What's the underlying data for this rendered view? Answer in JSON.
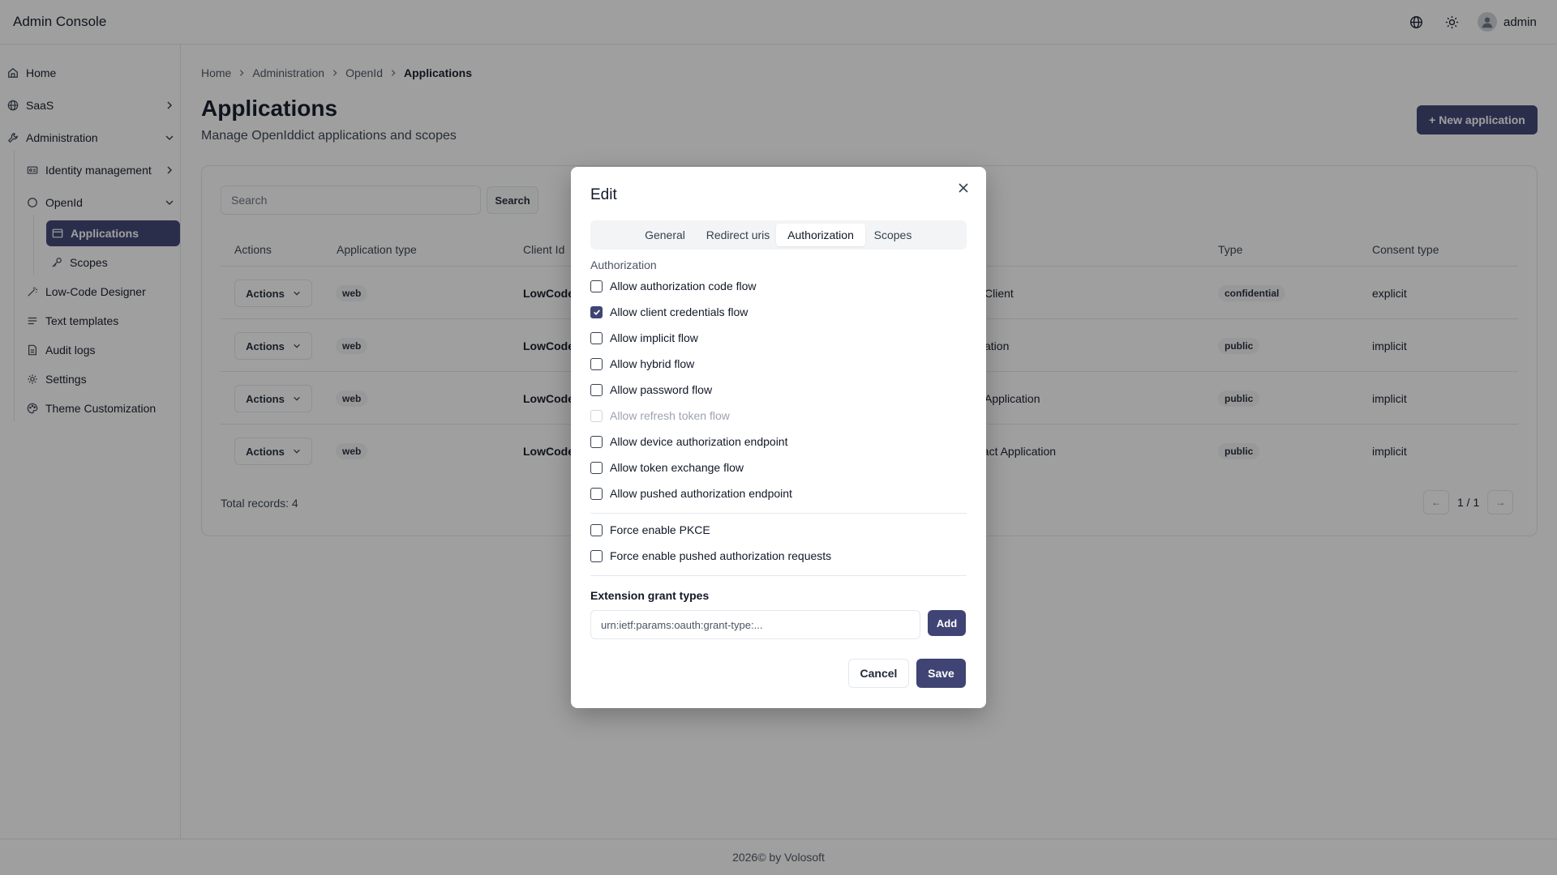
{
  "header": {
    "title": "Admin Console",
    "user": "admin",
    "icons": [
      "globe-icon",
      "sun-icon",
      "user-avatar-icon"
    ]
  },
  "sidebar": {
    "items": [
      {
        "label": "Home",
        "icon": "home-icon"
      },
      {
        "label": "SaaS",
        "icon": "globe-icon"
      },
      {
        "label": "Administration",
        "icon": "wrench-icon"
      },
      {
        "label": "Identity management",
        "icon": "id-card-icon"
      },
      {
        "label": "OpenId",
        "icon": "circle-icon"
      },
      {
        "label": "Applications",
        "icon": "window-icon",
        "active": true
      },
      {
        "label": "Scopes",
        "icon": "key-icon"
      },
      {
        "label": "Low-Code Designer",
        "icon": "magic-wand-icon"
      },
      {
        "label": "Text templates",
        "icon": "lines-icon"
      },
      {
        "label": "Audit logs",
        "icon": "file-icon"
      },
      {
        "label": "Settings",
        "icon": "gear-icon"
      },
      {
        "label": "Theme Customization",
        "icon": "palette-icon"
      }
    ]
  },
  "breadcrumb": [
    "Home",
    "Administration",
    "OpenId",
    "Applications"
  ],
  "page": {
    "title": "Applications",
    "subtitle": "Manage OpenIddict applications and scopes",
    "new_button": "+ New application"
  },
  "search": {
    "placeholder": "Search",
    "button": "Search"
  },
  "table": {
    "headers": [
      "Actions",
      "Application type",
      "Client Id",
      "Type",
      "Consent type"
    ],
    "rows": [
      {
        "actions": "Actions",
        "app_type": "web",
        "client_id": "LowCode",
        "display_fragment": "Client",
        "type": "confidential",
        "consent": "explicit"
      },
      {
        "actions": "Actions",
        "app_type": "web",
        "client_id": "LowCode",
        "display_fragment": "ation",
        "type": "public",
        "consent": "implicit"
      },
      {
        "actions": "Actions",
        "app_type": "web",
        "client_id": "LowCode",
        "display_fragment": "Application",
        "type": "public",
        "consent": "implicit"
      },
      {
        "actions": "Actions",
        "app_type": "web",
        "client_id": "LowCode",
        "display_fragment": "eact Application",
        "type": "public",
        "consent": "implicit"
      }
    ],
    "total": "Total records: 4",
    "pager": {
      "prev": "←",
      "text": "1 / 1",
      "next": "→"
    }
  },
  "footer": "2026© by Volosoft",
  "modal": {
    "title": "Edit",
    "tabs": [
      {
        "label": "General",
        "active": false
      },
      {
        "label": "Redirect uris",
        "active": false
      },
      {
        "label": "Authorization",
        "active": true
      },
      {
        "label": "Scopes",
        "active": false
      }
    ],
    "section_label": "Authorization",
    "flows": [
      {
        "label": "Allow authorization code flow",
        "checked": false,
        "disabled": false
      },
      {
        "label": "Allow client credentials flow",
        "checked": true,
        "disabled": false
      },
      {
        "label": "Allow implicit flow",
        "checked": false,
        "disabled": false
      },
      {
        "label": "Allow hybrid flow",
        "checked": false,
        "disabled": false
      },
      {
        "label": "Allow password flow",
        "checked": false,
        "disabled": false
      },
      {
        "label": "Allow refresh token flow",
        "checked": false,
        "disabled": true
      },
      {
        "label": "Allow device authorization endpoint",
        "checked": false,
        "disabled": false
      },
      {
        "label": "Allow token exchange flow",
        "checked": false,
        "disabled": false
      },
      {
        "label": "Allow pushed authorization endpoint",
        "checked": false,
        "disabled": false
      }
    ],
    "force": [
      {
        "label": "Force enable PKCE",
        "checked": false
      },
      {
        "label": "Force enable pushed authorization requests",
        "checked": false
      }
    ],
    "extension": {
      "label": "Extension grant types",
      "placeholder": "urn:ietf:params:oauth:grant-type:...",
      "add_button": "Add"
    },
    "cancel_button": "Cancel",
    "save_button": "Save"
  },
  "colors": {
    "accent": "#3f4474",
    "border": "#e5e7eb",
    "overlay": "rgba(15,15,15,0.40)"
  }
}
